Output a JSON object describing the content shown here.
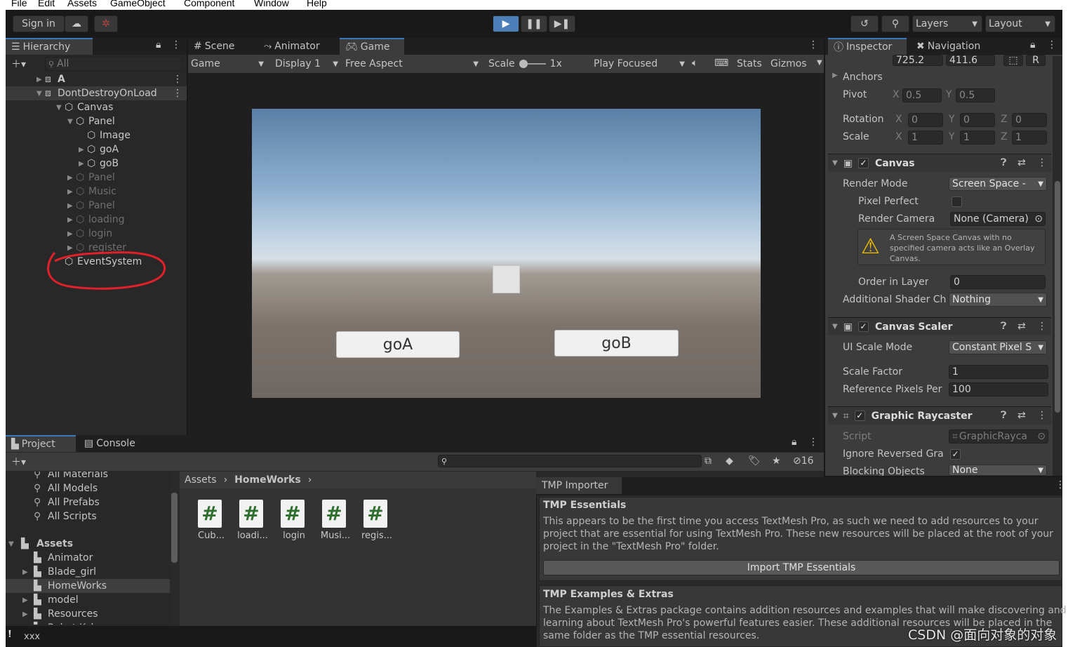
{
  "menu": [
    "File",
    "Edit",
    "Assets",
    "GameObject",
    "Component",
    "Window",
    "Help"
  ],
  "toolbar": {
    "sign_in": "Sign in",
    "layers": "Layers",
    "layout": "Layout"
  },
  "hierarchy": {
    "tab": "Hierarchy",
    "search_placeholder": "All",
    "items": [
      {
        "label": "A",
        "indent": 0,
        "arrow": "▶",
        "dim": false
      },
      {
        "label": "DontDestroyOnLoad",
        "indent": 0,
        "arrow": "▼",
        "dim": false
      },
      {
        "label": "Canvas",
        "indent": 1,
        "arrow": "▼",
        "dim": false
      },
      {
        "label": "Panel",
        "indent": 2,
        "arrow": "▼",
        "dim": false
      },
      {
        "label": "Image",
        "indent": 3,
        "arrow": "",
        "dim": false
      },
      {
        "label": "goA",
        "indent": 3,
        "arrow": "▶",
        "dim": false
      },
      {
        "label": "goB",
        "indent": 3,
        "arrow": "▶",
        "dim": false
      },
      {
        "label": "Panel",
        "indent": 2,
        "arrow": "▶",
        "dim": true
      },
      {
        "label": "Music",
        "indent": 2,
        "arrow": "▶",
        "dim": true
      },
      {
        "label": "Panel",
        "indent": 2,
        "arrow": "▶",
        "dim": true
      },
      {
        "label": "loading",
        "indent": 2,
        "arrow": "▶",
        "dim": true
      },
      {
        "label": "login",
        "indent": 2,
        "arrow": "▶",
        "dim": true
      },
      {
        "label": "register",
        "indent": 2,
        "arrow": "▶",
        "dim": true
      },
      {
        "label": "EventSystem",
        "indent": 1,
        "arrow": "",
        "dim": false
      }
    ]
  },
  "center_tabs": [
    "Scene",
    "Animator",
    "Game"
  ],
  "game_bar": {
    "game": "Game",
    "display": "Display 1",
    "aspect": "Free Aspect",
    "scale_label": "Scale",
    "scale_value": "1x",
    "play_focused": "Play Focused",
    "stats": "Stats",
    "gizmos": "Gizmos"
  },
  "game_view": {
    "button_a": "goA",
    "button_b": "goB"
  },
  "inspector": {
    "tabs": [
      "Inspector",
      "Navigation"
    ],
    "top_values": [
      "725.2",
      "411.6"
    ],
    "R": "R",
    "anchors": "Anchors",
    "pivot": {
      "label": "Pivot",
      "x": "0.5",
      "y": "0.5"
    },
    "rotation": {
      "label": "Rotation",
      "x": "0",
      "y": "0",
      "z": "0"
    },
    "scale": {
      "label": "Scale",
      "x": "1",
      "y": "1",
      "z": "1"
    },
    "axis": {
      "x": "X",
      "y": "Y",
      "z": "Z"
    },
    "canvas": {
      "title": "Canvas",
      "render_mode_label": "Render Mode",
      "render_mode": "Screen Space -",
      "pixel_perfect": "Pixel Perfect",
      "render_camera_label": "Render Camera",
      "render_camera": "None (Camera)",
      "warning": "A Screen Space Canvas with no specified camera acts like an Overlay Canvas.",
      "order_label": "Order in Layer",
      "order": "0",
      "shader_label": "Additional Shader Ch",
      "shader": "Nothing"
    },
    "scaler": {
      "title": "Canvas Scaler",
      "mode_label": "UI Scale Mode",
      "mode": "Constant Pixel S",
      "factor_label": "Scale Factor",
      "factor": "1",
      "ref_label": "Reference Pixels Per",
      "ref": "100"
    },
    "raycaster": {
      "title": "Graphic Raycaster",
      "script_label": "Script",
      "script": "GraphicRayca",
      "ignore_label": "Ignore Reversed Gra",
      "blocking_label": "Blocking Objects",
      "blocking": "None"
    }
  },
  "project": {
    "tabs": [
      "Project",
      "Console"
    ],
    "favorites": [
      "All Materials",
      "All Models",
      "All Prefabs",
      "All Scripts"
    ],
    "assets_root": "Assets",
    "folders": [
      {
        "label": "Animator",
        "arrow": ""
      },
      {
        "label": "Blade_girl",
        "arrow": "▶"
      },
      {
        "label": "HomeWorks",
        "arrow": ""
      },
      {
        "label": "model",
        "arrow": "▶"
      },
      {
        "label": "Resources",
        "arrow": "▶"
      },
      {
        "label": "Robot Kyle",
        "arrow": "▶"
      }
    ],
    "breadcrumb": [
      "Assets",
      "HomeWorks"
    ],
    "files": [
      "Cub...",
      "loadi...",
      "login",
      "Musi...",
      "regis..."
    ],
    "hidden_count": "16"
  },
  "tmp": {
    "title": "TMP Importer",
    "essentials_title": "TMP Essentials",
    "essentials_text": "This appears to be the first time you access TextMesh Pro, as such we need to add resources to your project that are essential for using TextMesh Pro. These new resources will be placed at the root of your project in the \"TextMesh Pro\" folder.",
    "import_button": "Import TMP Essentials",
    "extras_title": "TMP Examples & Extras",
    "extras_text": "The Examples & Extras package contains addition resources and examples that will make discovering and learning about TextMesh Pro's powerful features easier. These additional resources will be placed in the same folder as the TMP essential resources."
  },
  "status": {
    "text": "xxx"
  },
  "watermark": "CSDN @面向对象的对象",
  "colors": {
    "accent": "#3a79bb",
    "annotation": "#e0202a"
  }
}
